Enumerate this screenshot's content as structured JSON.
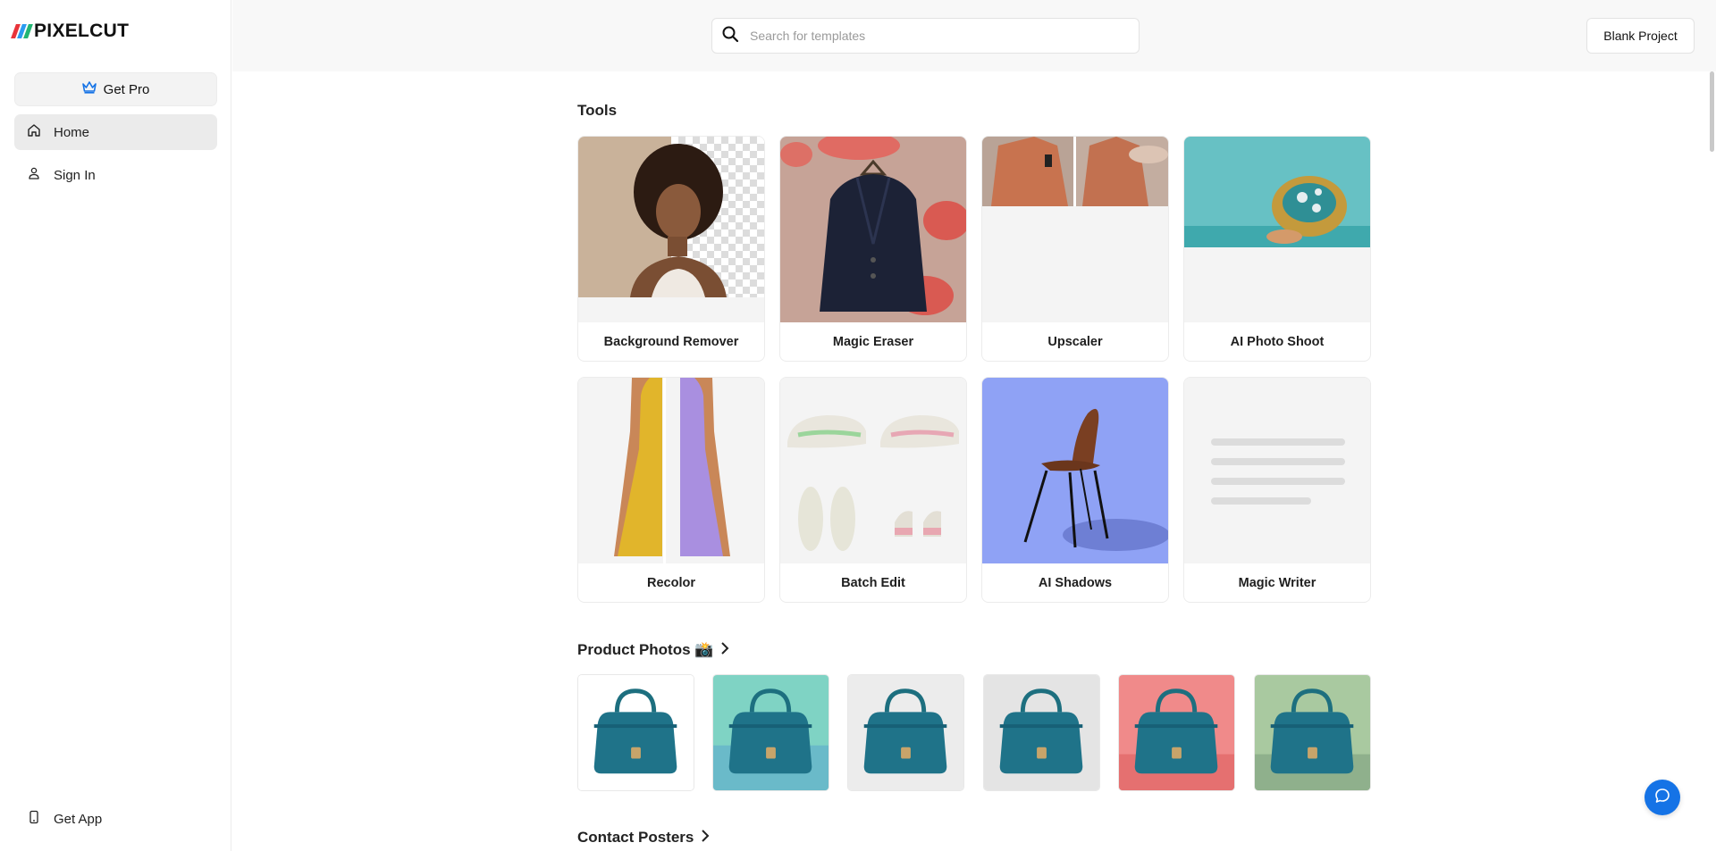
{
  "brand": {
    "name": "PIXELCUT",
    "colors": [
      "#e8343a",
      "#2b9bf0",
      "#f7b500",
      "#22b573"
    ]
  },
  "sidebar": {
    "get_pro": "Get Pro",
    "items": [
      {
        "label": "Home",
        "icon": "home-icon",
        "active": true
      },
      {
        "label": "Sign In",
        "icon": "user-icon",
        "active": false
      }
    ],
    "get_app": "Get App"
  },
  "topbar": {
    "search_placeholder": "Search for templates",
    "blank_project": "Blank Project"
  },
  "sections": {
    "tools": "Tools",
    "product_photos": "Product Photos 📸",
    "contact_posters": "Contact Posters"
  },
  "tools": [
    {
      "label": "Background Remover"
    },
    {
      "label": "Magic Eraser"
    },
    {
      "label": "Upscaler"
    },
    {
      "label": "AI Photo Shoot"
    },
    {
      "label": "Recolor"
    },
    {
      "label": "Batch Edit"
    },
    {
      "label": "AI Shadows"
    },
    {
      "label": "Magic Writer"
    }
  ],
  "product_photos": [
    {
      "bg": "#ffffff"
    },
    {
      "bg": "#7fd3c4"
    },
    {
      "bg": "#ececec"
    },
    {
      "bg": "#e4e4e4"
    },
    {
      "bg": "#f08a8a"
    },
    {
      "bg": "#a9c9a0"
    }
  ],
  "accent": "#1573e6"
}
